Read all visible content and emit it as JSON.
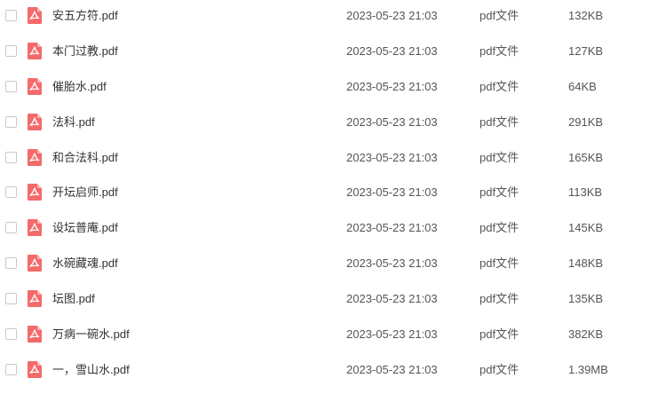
{
  "icons": {
    "file_icon": "pdf-file-icon",
    "icon_color": "#f46a6a"
  },
  "files": [
    {
      "name": "安五方符.pdf",
      "modified": "2023-05-23 21:03",
      "type": "pdf文件",
      "size": "132KB"
    },
    {
      "name": "本门过教.pdf",
      "modified": "2023-05-23 21:03",
      "type": "pdf文件",
      "size": "127KB"
    },
    {
      "name": "催胎水.pdf",
      "modified": "2023-05-23 21:03",
      "type": "pdf文件",
      "size": "64KB"
    },
    {
      "name": "法科.pdf",
      "modified": "2023-05-23 21:03",
      "type": "pdf文件",
      "size": "291KB"
    },
    {
      "name": "和合法科.pdf",
      "modified": "2023-05-23 21:03",
      "type": "pdf文件",
      "size": "165KB"
    },
    {
      "name": "开坛启师.pdf",
      "modified": "2023-05-23 21:03",
      "type": "pdf文件",
      "size": "113KB"
    },
    {
      "name": "设坛普庵.pdf",
      "modified": "2023-05-23 21:03",
      "type": "pdf文件",
      "size": "145KB"
    },
    {
      "name": "水碗藏魂.pdf",
      "modified": "2023-05-23 21:03",
      "type": "pdf文件",
      "size": "148KB"
    },
    {
      "name": "坛图.pdf",
      "modified": "2023-05-23 21:03",
      "type": "pdf文件",
      "size": "135KB"
    },
    {
      "name": "万病一碗水.pdf",
      "modified": "2023-05-23 21:03",
      "type": "pdf文件",
      "size": "382KB"
    },
    {
      "name": "一，雪山水.pdf",
      "modified": "2023-05-23 21:03",
      "type": "pdf文件",
      "size": "1.39MB"
    }
  ]
}
